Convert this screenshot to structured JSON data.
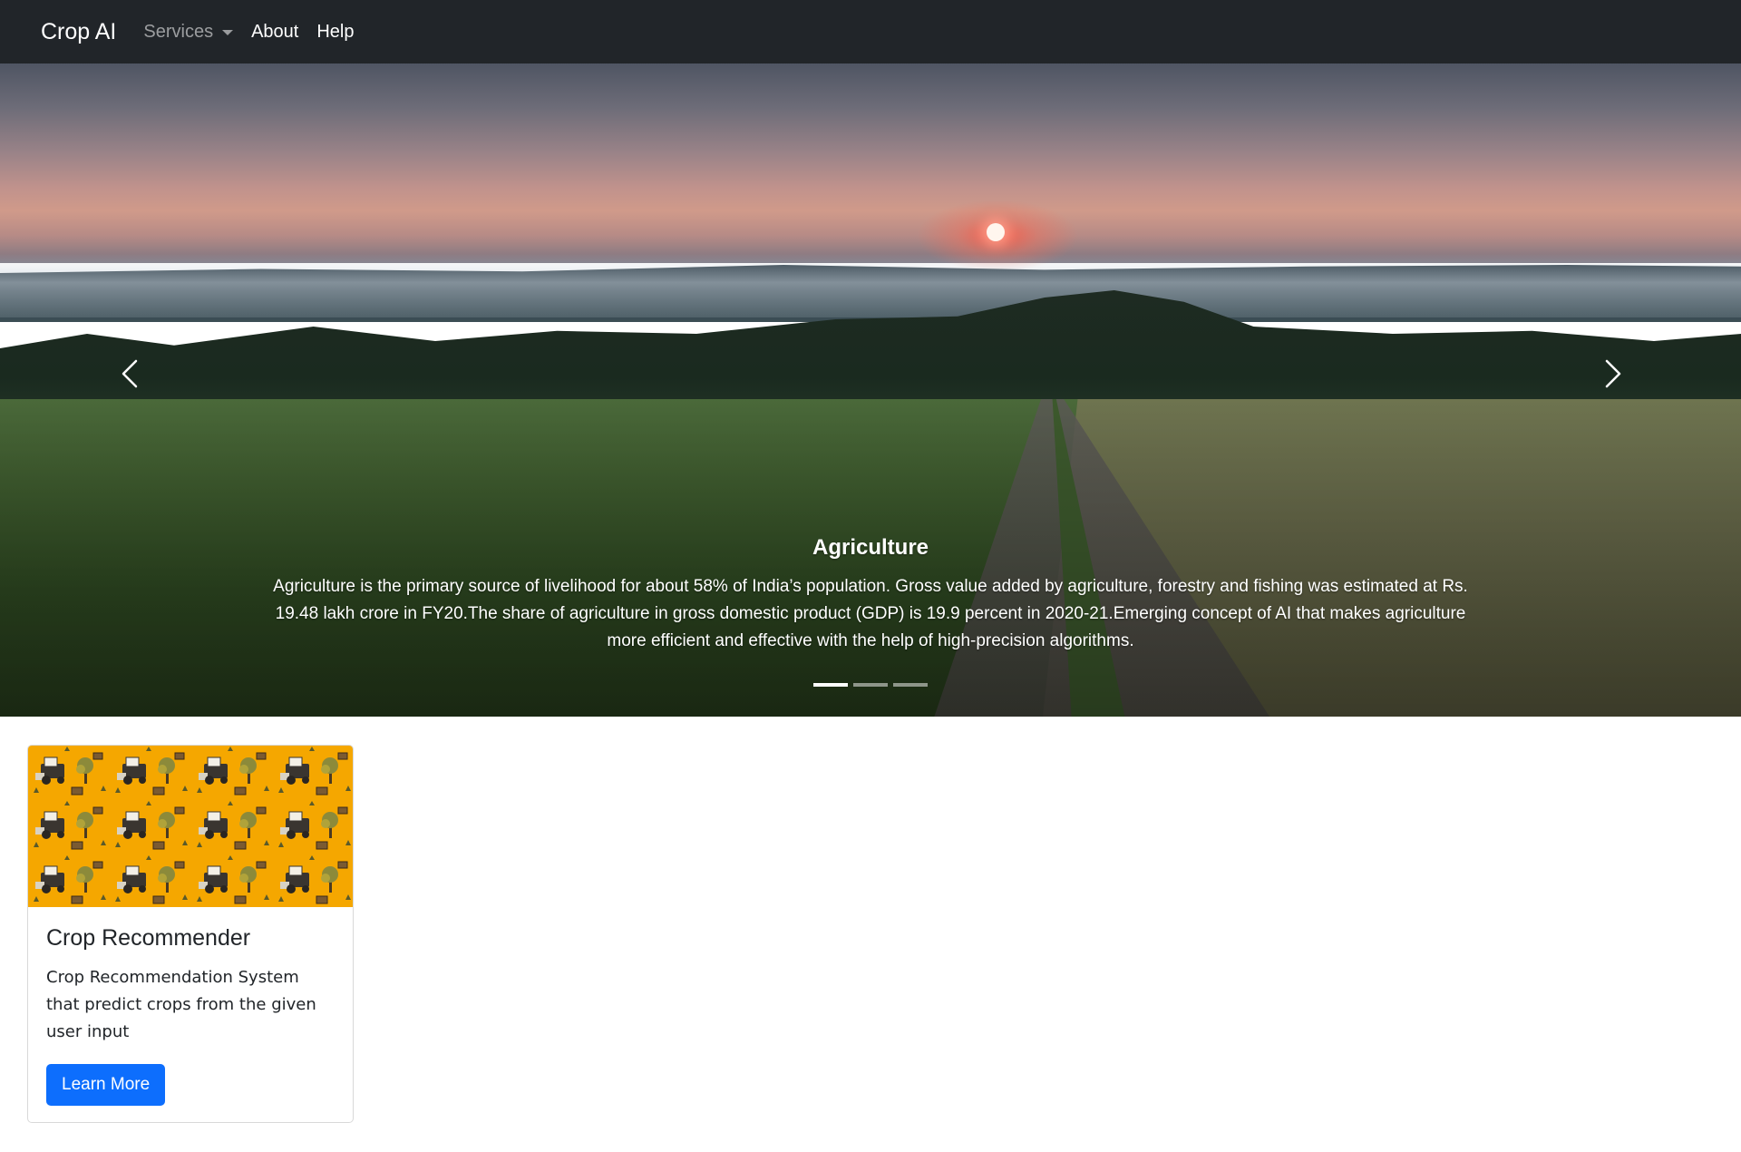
{
  "navbar": {
    "brand": "Crop AI",
    "items": [
      {
        "label": "Services",
        "has_dropdown": true
      },
      {
        "label": "About"
      },
      {
        "label": "Help"
      }
    ]
  },
  "carousel": {
    "slide": {
      "title": "Agriculture",
      "text": "Agriculture is the primary source of livelihood for about 58% of India’s population. Gross value added by agriculture, forestry and fishing was estimated at Rs. 19.48 lakh crore in FY20.The share of agriculture in gross domestic product (GDP) is 19.9 percent in 2020-21.Emerging concept of AI that makes agriculture more efficient and effective with the help of high-precision algorithms."
    },
    "slide_count": 3,
    "active_index": 0,
    "prev_icon": "chevron-left-icon",
    "next_icon": "chevron-right-icon"
  },
  "card": {
    "title": "Crop Recommender",
    "text": "Crop Recommendation System that predict crops from the given user input",
    "button_label": "Learn More",
    "image_bg_color": "#f5a700"
  },
  "colors": {
    "navbar_bg": "#212529",
    "primary": "#0d6efd"
  }
}
